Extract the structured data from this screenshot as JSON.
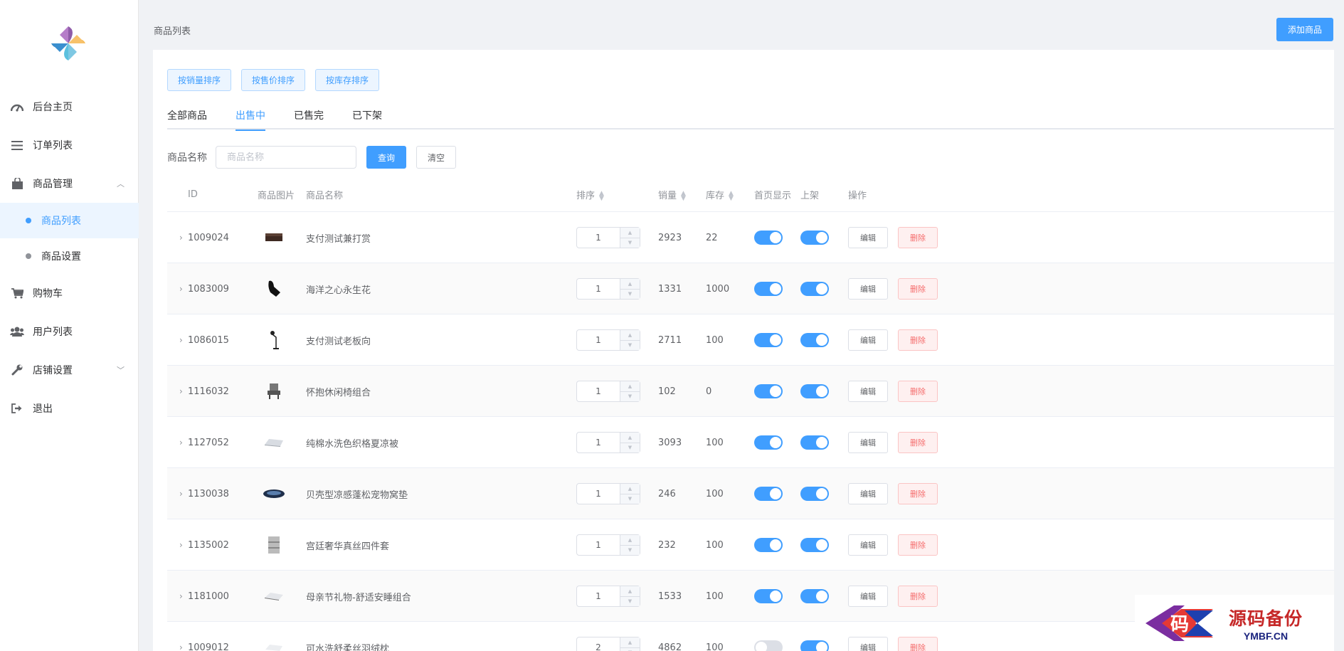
{
  "header": {
    "title": "商品列表",
    "add_button": "添加商品"
  },
  "sidebar": {
    "menu": [
      {
        "label": "后台主页",
        "icon": "dashboard-icon"
      },
      {
        "label": "订单列表",
        "icon": "list-icon"
      },
      {
        "label": "商品管理",
        "icon": "shopping-bag-icon",
        "expanded": true,
        "children": [
          {
            "label": "商品列表",
            "active": true
          },
          {
            "label": "商品设置",
            "active": false
          }
        ]
      },
      {
        "label": "购物车",
        "icon": "cart-icon"
      },
      {
        "label": "用户列表",
        "icon": "users-icon"
      },
      {
        "label": "店铺设置",
        "icon": "wrench-icon",
        "expanded": false
      },
      {
        "label": "退出",
        "icon": "logout-icon"
      }
    ]
  },
  "sort_buttons": [
    "按销量排序",
    "按售价排序",
    "按库存排序"
  ],
  "tabs": [
    {
      "label": "全部商品",
      "active": false
    },
    {
      "label": "出售中",
      "active": true
    },
    {
      "label": "已售完",
      "active": false
    },
    {
      "label": "已下架",
      "active": false
    }
  ],
  "search": {
    "label": "商品名称",
    "placeholder": "商品名称",
    "value": "",
    "query_button": "查询",
    "clear_button": "清空"
  },
  "table": {
    "columns": [
      "ID",
      "商品图片",
      "商品名称",
      "排序",
      "销量",
      "库存",
      "首页显示",
      "上架",
      "操作"
    ],
    "edit_label": "编辑",
    "delete_label": "删除",
    "rows": [
      {
        "id": "1009024",
        "name": "支付测试兼打赏",
        "sort": "1",
        "sales": "2923",
        "stock": "22",
        "home": true,
        "onsale": true,
        "thumb": "ottoman-thumb"
      },
      {
        "id": "1083009",
        "name": "海洋之心永生花",
        "sort": "1",
        "sales": "1331",
        "stock": "1000",
        "home": true,
        "onsale": true,
        "thumb": "chair-thumb"
      },
      {
        "id": "1086015",
        "name": "支付测试老板向",
        "sort": "1",
        "sales": "2711",
        "stock": "100",
        "home": true,
        "onsale": true,
        "thumb": "lamp-thumb"
      },
      {
        "id": "1116032",
        "name": "怀抱休闲椅组合",
        "sort": "1",
        "sales": "102",
        "stock": "0",
        "home": true,
        "onsale": true,
        "thumb": "armchair-thumb"
      },
      {
        "id": "1127052",
        "name": "纯棉水洗色织格夏凉被",
        "sort": "1",
        "sales": "3093",
        "stock": "100",
        "home": true,
        "onsale": true,
        "thumb": "quilt-thumb"
      },
      {
        "id": "1130038",
        "name": "贝壳型凉感蓬松宠物窝垫",
        "sort": "1",
        "sales": "246",
        "stock": "100",
        "home": true,
        "onsale": true,
        "thumb": "pet-bed-thumb"
      },
      {
        "id": "1135002",
        "name": "宫廷奢华真丝四件套",
        "sort": "1",
        "sales": "232",
        "stock": "100",
        "home": true,
        "onsale": true,
        "thumb": "bedding-thumb"
      },
      {
        "id": "1181000",
        "name": "母亲节礼物-舒适安睡组合",
        "sort": "1",
        "sales": "1533",
        "stock": "100",
        "home": true,
        "onsale": true,
        "thumb": "pillow-set-thumb"
      },
      {
        "id": "1009012",
        "name": "可水洗舒柔丝羽绒枕",
        "sort": "2",
        "sales": "4862",
        "stock": "100",
        "home": false,
        "onsale": true,
        "thumb": "pillow-thumb"
      }
    ]
  },
  "watermark": {
    "cn": "源码备份",
    "en": "YMBF.CN",
    "logo_text": "码"
  },
  "colors": {
    "primary": "#409eff",
    "danger": "#f56c6c",
    "sidebar_active_bg": "#ecf5ff"
  }
}
